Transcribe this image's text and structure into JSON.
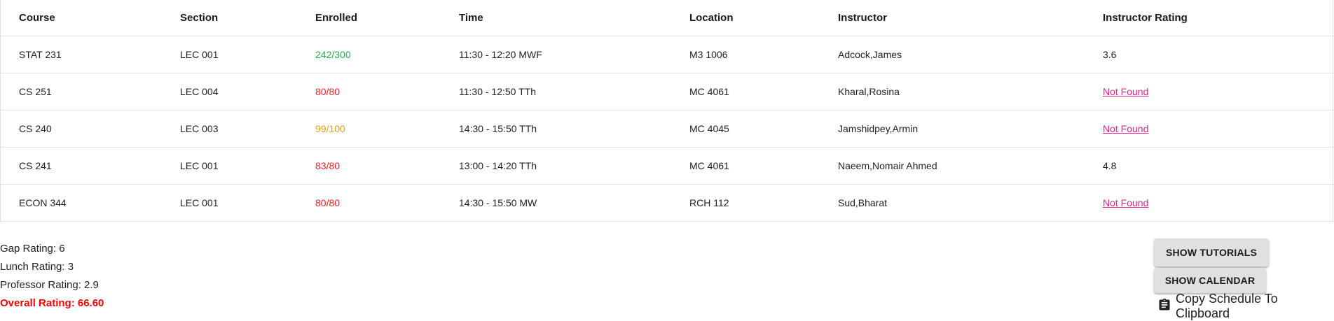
{
  "table": {
    "headers": [
      "Course",
      "Section",
      "Enrolled",
      "Time",
      "Location",
      "Instructor",
      "Instructor Rating"
    ],
    "rows": [
      {
        "course": "STAT 231",
        "section": "LEC 001",
        "enrolled": "242/300",
        "enrolled_status": "green",
        "time": "11:30 - 12:20 MWF",
        "location": "M3 1006",
        "instructor": "Adcock,James",
        "rating": "3.6"
      },
      {
        "course": "CS 251",
        "section": "LEC 004",
        "enrolled": "80/80",
        "enrolled_status": "red",
        "time": "11:30 - 12:50 TTh",
        "location": "MC 4061",
        "instructor": "Kharal,Rosina",
        "rating": "Not Found"
      },
      {
        "course": "CS 240",
        "section": "LEC 003",
        "enrolled": "99/100",
        "enrolled_status": "orange",
        "time": "14:30 - 15:50 TTh",
        "location": "MC 4045",
        "instructor": "Jamshidpey,Armin",
        "rating": "Not Found"
      },
      {
        "course": "CS 241",
        "section": "LEC 001",
        "enrolled": "83/80",
        "enrolled_status": "red",
        "time": "13:00 - 14:20 TTh",
        "location": "MC 4061",
        "instructor": "Naeem,Nomair Ahmed",
        "rating": "4.8"
      },
      {
        "course": "ECON 344",
        "section": "LEC 001",
        "enrolled": "80/80",
        "enrolled_status": "red",
        "time": "14:30 - 15:50 MW",
        "location": "RCH 112",
        "instructor": "Sud,Bharat",
        "rating": "Not Found"
      }
    ]
  },
  "ratings": {
    "gap": "Gap Rating: 6",
    "lunch": "Lunch Rating: 3",
    "professor": "Professor Rating: 2.9",
    "overall": "Overall Rating: 66.60"
  },
  "buttons": {
    "tutorials": "Show Tutorials",
    "calendar": "Show Calendar",
    "copy": "Copy Schedule To Clipboard"
  },
  "icons": {
    "copy": "clipboard-icon"
  },
  "colors": {
    "enrolled_green": "#22b24c",
    "enrolled_red": "#ff1a1a",
    "enrolled_orange": "#f59b0b",
    "not_found_link": "#e91e8c",
    "overall_rating": "#ff0000"
  }
}
